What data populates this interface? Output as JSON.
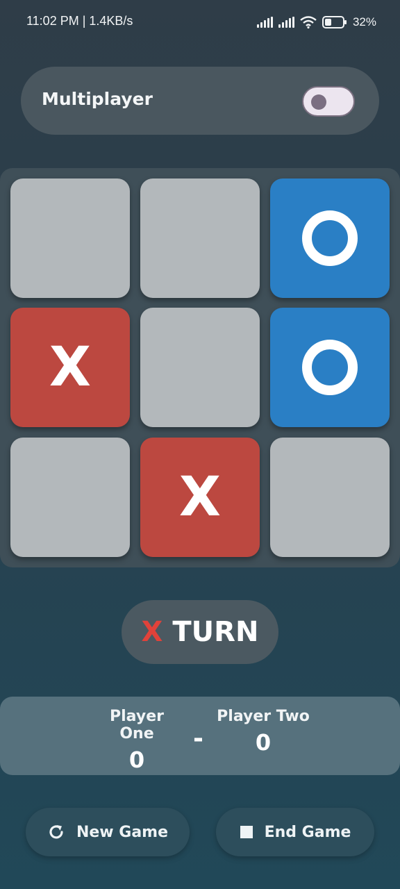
{
  "status_bar": {
    "time_speed": "11:02 PM | 1.4KB/s",
    "battery": "32%"
  },
  "multiplayer": {
    "label": "Multiplayer",
    "enabled": false
  },
  "board": {
    "cells": [
      "",
      "",
      "O",
      "X",
      "",
      "O",
      "",
      "X",
      ""
    ],
    "colors": {
      "empty": "#b3b8bb",
      "x": "#bc4840",
      "o": "#2a7fc5"
    }
  },
  "turn": {
    "mark": "X",
    "label": "TURN"
  },
  "scoreboard": {
    "player_one": {
      "name": "Player One",
      "score": "0"
    },
    "separator": "-",
    "player_two": {
      "name": "Player Two",
      "score": "0"
    }
  },
  "buttons": {
    "new_game": {
      "label": "New Game",
      "icon": "refresh-icon"
    },
    "end_game": {
      "label": "End Game",
      "icon": "stop-icon"
    }
  }
}
